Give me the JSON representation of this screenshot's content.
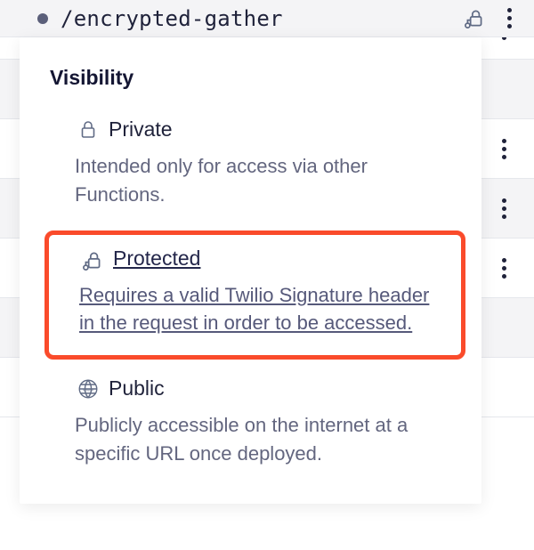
{
  "top": {
    "path": "/encrypted-gather"
  },
  "popover": {
    "heading": "Visibility",
    "private": {
      "title": "Private",
      "desc": "Intended only for access via other Functions."
    },
    "protected": {
      "title": "Protected",
      "desc": "Requires a valid Twilio Signature header in the request in order to be accessed."
    },
    "public": {
      "title": "Public",
      "desc": "Publicly accessible on the internet at a specific URL once deployed."
    }
  },
  "colors": {
    "highlight": "#fa4b2b"
  }
}
